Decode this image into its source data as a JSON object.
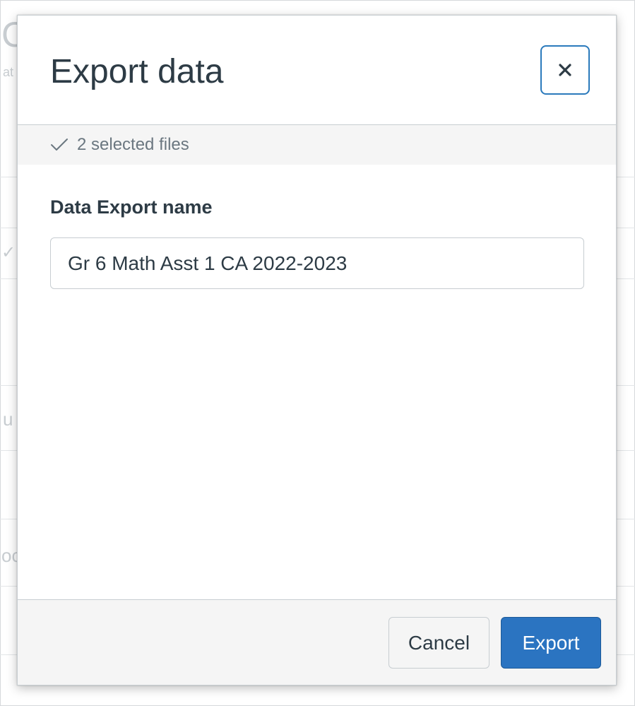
{
  "background": {
    "glyphs": [
      "C",
      "at",
      "u",
      "oc"
    ]
  },
  "modal": {
    "title": "Export data",
    "close_icon": "close-icon",
    "selection": {
      "icon": "checkmark-icon",
      "text": "2 selected files"
    },
    "field": {
      "label": "Data Export name",
      "value": "Gr 6 Math Asst 1 CA 2022-2023"
    },
    "footer": {
      "cancel_label": "Cancel",
      "export_label": "Export"
    }
  },
  "colors": {
    "accent": "#2b74c1",
    "focus_ring": "#2b7abc",
    "text": "#2d3b45",
    "muted_text": "#6b7780",
    "panel_bg": "#f5f5f5",
    "border": "#c7cdd1"
  }
}
